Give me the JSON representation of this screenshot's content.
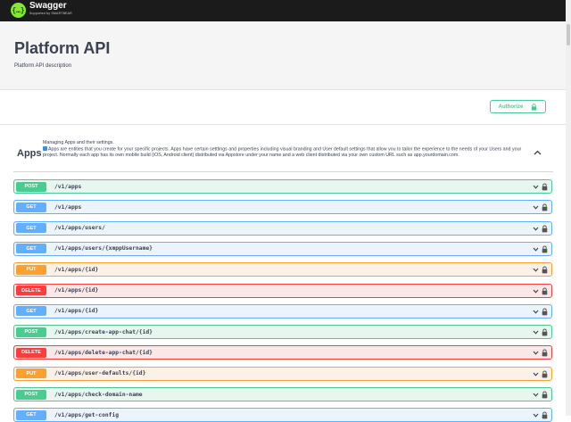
{
  "header": {
    "logo_mark": "{…}",
    "logo_title": "Swagger",
    "logo_subtitle": "Supported by SMARTBEAR"
  },
  "info": {
    "title": "Platform API",
    "description": "Platform API description"
  },
  "authorize": {
    "label": "Authorize"
  },
  "tag": {
    "name": "Apps",
    "description_line1": "Managing Apps and their settings.",
    "description_line2": "Apps are entities that you create for your specific projects. Apps have certain setttings and properties including visual branding and User default settings that allow you to tailor the experience to the needs of your Users and your project. Normally each app has its own mobile build (iOS, Android client) distributed via Appstore under your name and a web client distributed via your own custom URL such as app.yourdomain.com."
  },
  "colors": {
    "POST": {
      "accent": "#49cc90",
      "bg": "#e8f6f0",
      "border": "#49cc90"
    },
    "GET": {
      "accent": "#61affe",
      "bg": "#ebf3fb",
      "border": "#61affe"
    },
    "PUT": {
      "accent": "#fca130",
      "bg": "#fbf1e6",
      "border": "#fca130"
    },
    "DELETE": {
      "accent": "#f93e3e",
      "bg": "#fae7e7",
      "border": "#f93e3e"
    }
  },
  "operations": [
    {
      "method": "POST",
      "path": "/v1/apps"
    },
    {
      "method": "GET",
      "path": "/v1/apps"
    },
    {
      "method": "GET",
      "path": "/v1/apps/users/"
    },
    {
      "method": "GET",
      "path": "/v1/apps/users/{xmppUsername}"
    },
    {
      "method": "PUT",
      "path": "/v1/apps/{id}"
    },
    {
      "method": "DELETE",
      "path": "/v1/apps/{id}"
    },
    {
      "method": "GET",
      "path": "/v1/apps/{id}"
    },
    {
      "method": "POST",
      "path": "/v1/apps/create-app-chat/{id}"
    },
    {
      "method": "DELETE",
      "path": "/v1/apps/delete-app-chat/{id}"
    },
    {
      "method": "PUT",
      "path": "/v1/apps/user-defaults/{id}"
    },
    {
      "method": "POST",
      "path": "/v1/apps/check-domain-name"
    },
    {
      "method": "GET",
      "path": "/v1/apps/get-config"
    }
  ]
}
